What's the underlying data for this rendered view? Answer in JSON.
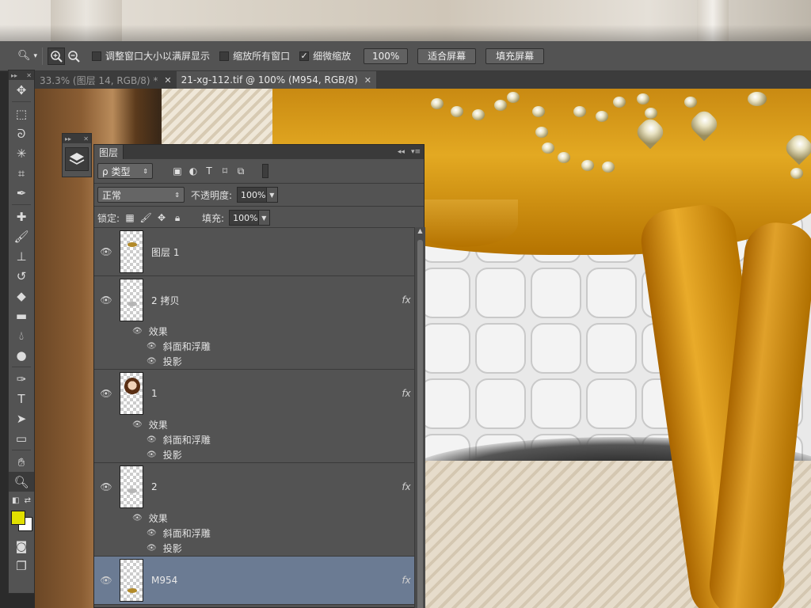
{
  "options_bar": {
    "checkbox_resize": "调整窗口大小以满屏显示",
    "checkbox_all_windows": "缩放所有窗口",
    "checkbox_scrubby": "细微缩放",
    "btn_100": "100%",
    "btn_fit": "适合屏幕",
    "btn_fill": "填充屏幕"
  },
  "tabs": [
    {
      "label": "33.3% (图层 14, RGB/8) *",
      "close": "✕"
    },
    {
      "label": "21-xg-112.tif @ 100% (M954, RGB/8)",
      "close": "✕"
    }
  ],
  "layers_panel": {
    "tab_label": "图层",
    "filter_kind": "类型",
    "blend_mode": "正常",
    "opacity_label": "不透明度:",
    "opacity_value": "100%",
    "lock_label": "锁定:",
    "fill_label": "填充:",
    "fill_value": "100%",
    "fx_label": "fx",
    "layers": [
      {
        "name": "图层 1",
        "effects": null
      },
      {
        "name": "2 拷贝",
        "effects": {
          "title": "效果",
          "items": [
            "斜面和浮雕",
            "投影"
          ]
        }
      },
      {
        "name": "1",
        "effects": {
          "title": "效果",
          "items": [
            "斜面和浮雕",
            "投影"
          ]
        }
      },
      {
        "name": "2",
        "effects": {
          "title": "效果",
          "items": [
            "斜面和浮雕",
            "投影"
          ]
        }
      },
      {
        "name": "M954",
        "effects": null,
        "selected": true
      }
    ]
  },
  "colors": {
    "foreground": "#e2e000",
    "background": "#ffffff",
    "selected_layer": "#6b7b93"
  }
}
